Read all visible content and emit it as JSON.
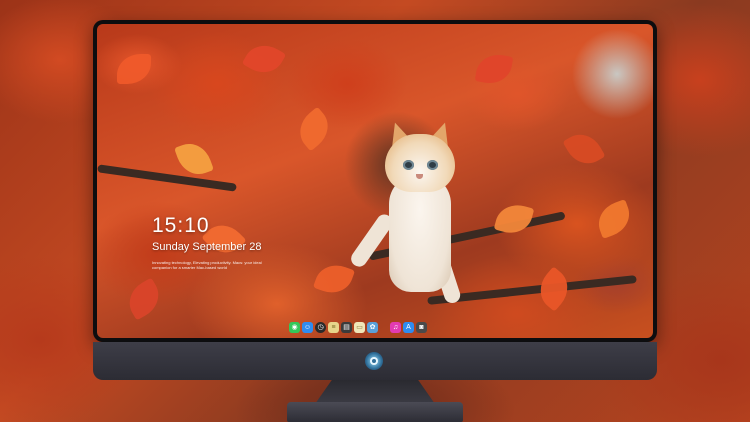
{
  "lock_screen": {
    "time": "15:10",
    "date": "Sunday September 28",
    "tagline": "Innovating technology, Elevating productivity. Macs: your ideal companion for a smarter Mac-based world"
  },
  "dock": {
    "items": [
      {
        "name": "messages",
        "glyph": "◉",
        "color": "#34c759"
      },
      {
        "name": "finder",
        "glyph": "☺",
        "color": "#2f8cf0"
      },
      {
        "name": "clock",
        "glyph": "◷",
        "color": "#2a2a2a"
      },
      {
        "name": "notes",
        "glyph": "≡",
        "color": "#e7d58a"
      },
      {
        "name": "clapper",
        "glyph": "▤",
        "color": "#3b3b3b"
      },
      {
        "name": "files",
        "glyph": "▭",
        "color": "#f0e6b8"
      },
      {
        "name": "photos",
        "glyph": "✿",
        "color": "#5aa0d8"
      },
      {
        "name": "music",
        "glyph": "♫",
        "color": "#e33bb2"
      },
      {
        "name": "app-store",
        "glyph": "A",
        "color": "#2f8cf0"
      },
      {
        "name": "camera",
        "glyph": "◙",
        "color": "#4a4a4a"
      }
    ]
  },
  "colors": {
    "bezel": "#0d0d0f",
    "chin": "#3e3e48",
    "text": "#ffffff"
  }
}
